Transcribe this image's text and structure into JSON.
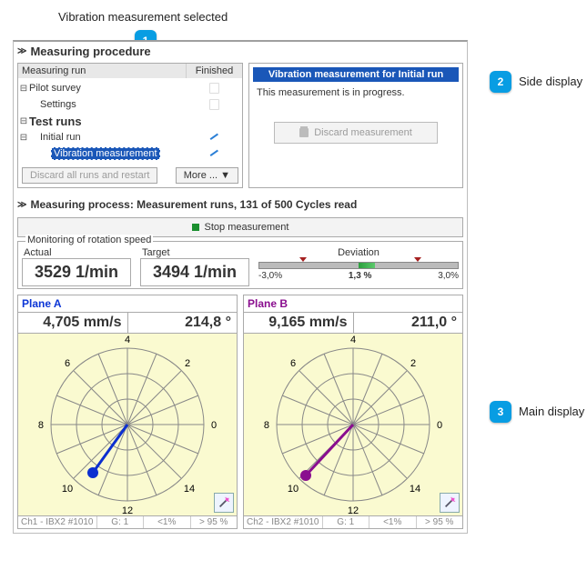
{
  "callouts": {
    "top_label": "Vibration measurement selected",
    "badge1": "1",
    "badge2": "2",
    "side_label": "Side display",
    "badge3": "3",
    "main_label": "Main display"
  },
  "procedure": {
    "header": "Measuring procedure",
    "col_run": "Measuring run",
    "col_finished": "Finished",
    "rows": {
      "pilot": "Pilot survey",
      "settings": "Settings",
      "test_runs": "Test runs",
      "initial_run": "Initial run",
      "vib_meas": "Vibration measurement"
    },
    "discard_all": "Discard all runs and restart",
    "more": "More ... ▼"
  },
  "side": {
    "title": "Vibration measurement for Initial run",
    "text": "This measurement is in progress.",
    "discard": "Discard measurement"
  },
  "process": {
    "header": "Measuring process: Measurement runs, 131 of 500 Cycles read",
    "stop": "Stop measurement",
    "monitor_label": "Monitoring of rotation speed",
    "actual_label": "Actual",
    "actual_value": "3529 1/min",
    "target_label": "Target",
    "target_value": "3494 1/min",
    "dev_label": "Deviation",
    "dev_left": "-3,0%",
    "dev_mid": "1,3 %",
    "dev_right": "3,0%"
  },
  "planes": {
    "a": {
      "title": "Plane A",
      "amp": "4,705 mm/s",
      "phase": "214,8 °",
      "foot_ch": "Ch1 - IBX2 #1010",
      "foot_g": "G: 1",
      "foot_lt": "<1%",
      "foot_gt": "> 95 %"
    },
    "b": {
      "title": "Plane B",
      "amp": "9,165 mm/s",
      "phase": "211,0 °",
      "foot_ch": "Ch2 - IBX2 #1010",
      "foot_g": "G: 1",
      "foot_lt": "<1%",
      "foot_gt": "> 95 %"
    },
    "ticks": {
      "t0": "0",
      "t2": "2",
      "t4": "4",
      "t6": "6",
      "t8": "8",
      "t10": "10",
      "t12": "12",
      "t14": "14"
    }
  },
  "chart_data": [
    {
      "type": "polar",
      "title": "Plane A",
      "radius_label": "mm/s",
      "angle_label": "deg",
      "series": [
        {
          "name": "Plane A",
          "r": 4.705,
          "theta_deg": 214.8,
          "color": "#0c2fd0"
        }
      ],
      "angle_ticks_deg": [
        0,
        45,
        90,
        135,
        180,
        225,
        270,
        315
      ],
      "angle_tick_labels": [
        "0",
        "2",
        "4",
        "6",
        "8",
        "10",
        "12",
        "14"
      ]
    },
    {
      "type": "polar",
      "title": "Plane B",
      "radius_label": "mm/s",
      "angle_label": "deg",
      "series": [
        {
          "name": "Plane B",
          "r": 9.165,
          "theta_deg": 211.0,
          "color": "#8a0e8f"
        }
      ],
      "angle_ticks_deg": [
        0,
        45,
        90,
        135,
        180,
        225,
        270,
        315
      ],
      "angle_tick_labels": [
        "0",
        "2",
        "4",
        "6",
        "8",
        "10",
        "12",
        "14"
      ]
    }
  ]
}
